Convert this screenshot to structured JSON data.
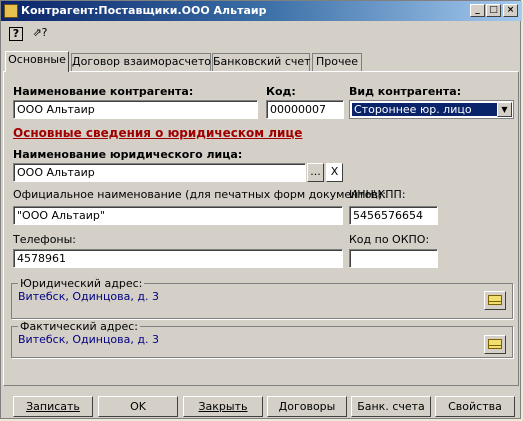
{
  "window": {
    "title": "Контрагент:Поставщики.ООО Альтаир",
    "controls": {
      "minimize": "_",
      "maximize": "□",
      "close": "×"
    }
  },
  "toolbar": {
    "help_icon": "?",
    "whatsthis_icon": "⇗?"
  },
  "tabs": [
    {
      "label": "Основные",
      "active": true
    },
    {
      "label": "Договор взаиморасчетов",
      "active": false
    },
    {
      "label": "Банковский счет",
      "active": false
    },
    {
      "label": "Прочее",
      "active": false
    }
  ],
  "form": {
    "name_label": "Наименование контрагента:",
    "name_value": "ООО Альтаир",
    "code_label": "Код:",
    "code_value": "00000007",
    "type_label": "Вид контрагента:",
    "type_value": "Стороннее юр. лицо",
    "section_title": "Основные сведения о юридическом лице",
    "legal_name_label": "Наименование юридического лица:",
    "legal_name_value": "ООО Альтаир",
    "legal_select_btn": "...",
    "legal_clear_btn": "X",
    "official_label": "Официальное наименование (для печатных форм документов):",
    "official_value": "\"ООО Альтаир\"",
    "inn_label": "ИНН\\КПП:",
    "inn_value": "5456576654",
    "phones_label": "Телефоны:",
    "phones_value": "4578961",
    "okpo_label": "Код по ОКПО:",
    "okpo_value": "",
    "legal_address_label": "Юридический адрес:",
    "legal_address_value": "Витебск, Одинцова, д. 3",
    "actual_address_label": "Фактический адрес:",
    "actual_address_value": "Витебск, Одинцова, д. 3"
  },
  "buttons": {
    "save": "Записать",
    "ok": "OK",
    "close": "Закрыть",
    "contracts": "Договоры",
    "bank_accounts": "Банк. счета",
    "properties": "Свойства"
  }
}
